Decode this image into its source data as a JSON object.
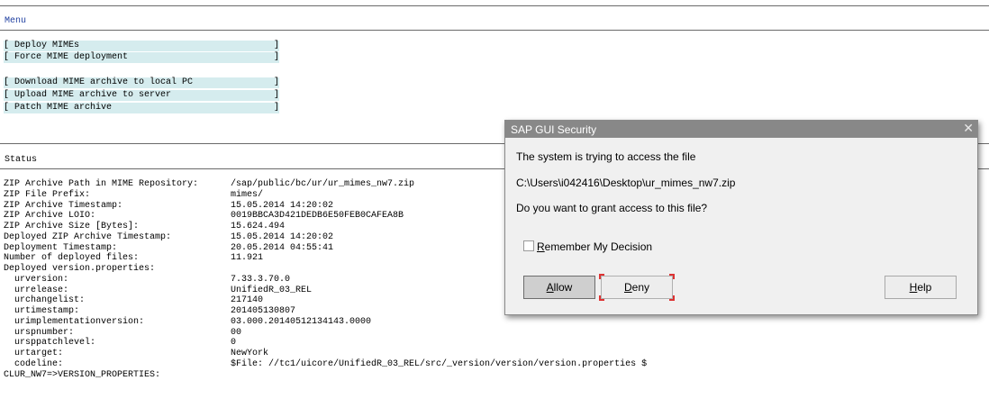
{
  "menu": {
    "title": "Menu",
    "items": [
      {
        "label": "[ Deploy MIMEs",
        "bracket": "]"
      },
      {
        "label": "[ Force MIME deployment",
        "bracket": "]"
      },
      {
        "label": "[ Download MIME archive to local PC",
        "bracket": "]"
      },
      {
        "label": "[ Upload MIME archive to server",
        "bracket": "]"
      },
      {
        "label": "[ Patch MIME archive",
        "bracket": "]"
      }
    ]
  },
  "status": {
    "title": "Status",
    "rows": [
      {
        "k": "ZIP Archive Path in MIME Repository:",
        "v": "/sap/public/bc/ur/ur_mimes_nw7.zip"
      },
      {
        "k": "ZIP File Prefix:",
        "v": "mimes/"
      },
      {
        "k": "ZIP Archive Timestamp:",
        "v": "15.05.2014 14:20:02"
      },
      {
        "k": "ZIP Archive LOIO:",
        "v": "0019BBCA3D421DEDB6E50FEB0CAFEA8B"
      },
      {
        "k": "ZIP Archive Size [Bytes]:",
        "v": "15.624.494"
      },
      {
        "k": "Deployed ZIP Archive Timestamp:",
        "v": "15.05.2014 14:20:02"
      },
      {
        "k": "Deployment Timestamp:",
        "v": "20.05.2014 04:55:41"
      },
      {
        "k": "Number of deployed files:",
        "v": "11.921"
      },
      {
        "k": "Deployed version.properties:",
        "v": ""
      },
      {
        "k": "  urversion:",
        "v": "7.33.3.70.0"
      },
      {
        "k": "  urrelease:",
        "v": "UnifiedR_03_REL"
      },
      {
        "k": "  urchangelist:",
        "v": "217140"
      },
      {
        "k": "  urtimestamp:",
        "v": "201405130807"
      },
      {
        "k": "  urimplementationversion:",
        "v": "03.000.20140512134143.0000"
      },
      {
        "k": "  urspnumber:",
        "v": "00"
      },
      {
        "k": "  ursppatchlevel:",
        "v": "0"
      },
      {
        "k": "  urtarget:",
        "v": "NewYork"
      },
      {
        "k": "  codeline:",
        "v": "$File: //tc1/uicore/UnifiedR_03_REL/src/_version/version/version.properties $"
      },
      {
        "k": "CLUR_NW7=>VERSION_PROPERTIES:",
        "v": ""
      }
    ]
  },
  "dialog": {
    "title": "SAP GUI Security",
    "close_glyph": "✕",
    "line1": "The system is trying to access the file",
    "path": "C:\\Users\\i042416\\Desktop\\ur_mimes_nw7.zip",
    "question": "Do you want to grant access to this file?",
    "remember_first": "R",
    "remember_rest": "emember My Decision",
    "allow_first": "A",
    "allow_rest": "llow",
    "deny_first": "D",
    "deny_rest": "eny",
    "help_first": "H",
    "help_rest": "elp"
  }
}
